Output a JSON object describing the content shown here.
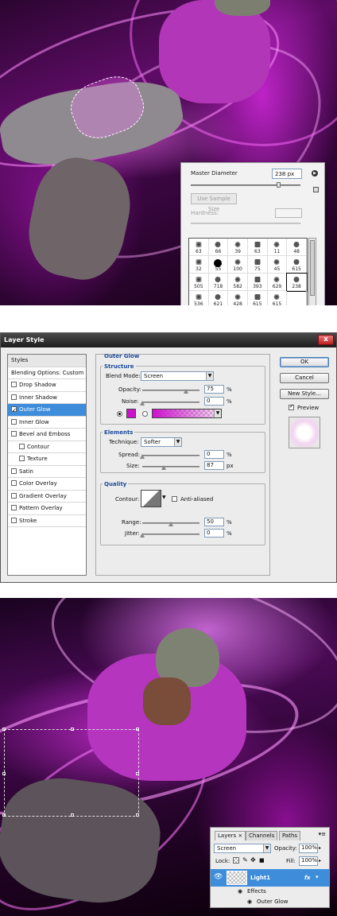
{
  "brush_panel": {
    "master_diameter_label": "Master Diameter",
    "master_diameter_value": "238 px",
    "use_sample_size_label": "Use Sample Size",
    "hardness_label": "Hardness:",
    "diameter_slider_fraction": 0.8,
    "brushes": [
      {
        "size": "63"
      },
      {
        "size": "66"
      },
      {
        "size": "39"
      },
      {
        "size": "63"
      },
      {
        "size": "11"
      },
      {
        "size": "48"
      },
      {
        "size": "32"
      },
      {
        "size": "55"
      },
      {
        "size": "100"
      },
      {
        "size": "75"
      },
      {
        "size": "45"
      },
      {
        "size": "615"
      },
      {
        "size": "505"
      },
      {
        "size": "718"
      },
      {
        "size": "582"
      },
      {
        "size": "393"
      },
      {
        "size": "629"
      },
      {
        "size": "238"
      },
      {
        "size": "536"
      },
      {
        "size": "621"
      },
      {
        "size": "428"
      },
      {
        "size": "615"
      },
      {
        "size": "615"
      },
      {
        "size": ""
      }
    ]
  },
  "dialog": {
    "title": "Layer Style",
    "close_label": "x",
    "styles_header": "Styles",
    "styles": [
      {
        "label": "Blending Options: Custom",
        "checkbox": false,
        "checked": false,
        "selected": false,
        "indent": false
      },
      {
        "label": "Drop Shadow",
        "checkbox": true,
        "checked": false,
        "selected": false,
        "indent": false
      },
      {
        "label": "Inner Shadow",
        "checkbox": true,
        "checked": false,
        "selected": false,
        "indent": false
      },
      {
        "label": "Outer Glow",
        "checkbox": true,
        "checked": true,
        "selected": true,
        "indent": false
      },
      {
        "label": "Inner Glow",
        "checkbox": true,
        "checked": false,
        "selected": false,
        "indent": false
      },
      {
        "label": "Bevel and Emboss",
        "checkbox": true,
        "checked": false,
        "selected": false,
        "indent": false
      },
      {
        "label": "Contour",
        "checkbox": true,
        "checked": false,
        "selected": false,
        "indent": true
      },
      {
        "label": "Texture",
        "checkbox": true,
        "checked": false,
        "selected": false,
        "indent": true
      },
      {
        "label": "Satin",
        "checkbox": true,
        "checked": false,
        "selected": false,
        "indent": false
      },
      {
        "label": "Color Overlay",
        "checkbox": true,
        "checked": false,
        "selected": false,
        "indent": false
      },
      {
        "label": "Gradient Overlay",
        "checkbox": true,
        "checked": false,
        "selected": false,
        "indent": false
      },
      {
        "label": "Pattern Overlay",
        "checkbox": true,
        "checked": false,
        "selected": false,
        "indent": false
      },
      {
        "label": "Stroke",
        "checkbox": true,
        "checked": false,
        "selected": false,
        "indent": false
      }
    ],
    "outer_glow": {
      "section_title": "Outer Glow",
      "structure_title": "Structure",
      "blend_mode_label": "Blend Mode:",
      "blend_mode_value": "Screen",
      "opacity_label": "Opacity:",
      "opacity_value": "75",
      "noise_label": "Noise:",
      "noise_value": "0",
      "percent": "%",
      "px": "px",
      "glow_color": "#cc11cc",
      "elements_title": "Elements",
      "technique_label": "Technique:",
      "technique_value": "Softer",
      "spread_label": "Spread:",
      "spread_value": "0",
      "size_label": "Size:",
      "size_value": "87",
      "quality_title": "Quality",
      "contour_label": "Contour:",
      "anti_aliased_label": "Anti-aliased",
      "range_label": "Range:",
      "range_value": "50",
      "jitter_label": "Jitter:",
      "jitter_value": "0"
    },
    "buttons": {
      "ok": "OK",
      "cancel": "Cancel",
      "new_style": "New Style...",
      "preview": "Preview"
    }
  },
  "layers_panel": {
    "tabs": [
      "Layers ×",
      "Channels",
      "Paths"
    ],
    "blend_mode": "Screen",
    "opacity_label": "Opacity:",
    "opacity_value": "100%",
    "lock_label": "Lock:",
    "fill_label": "Fill:",
    "fill_value": "100%",
    "layer_name": "Light1",
    "fx_label": "fx",
    "effects_label": "Effects",
    "outer_glow_label": "Outer Glow"
  },
  "colors": {
    "magenta_glow": "#cc11cc",
    "selection_blue": "#3d8ddb",
    "legend_blue": "#1b4a9b"
  }
}
